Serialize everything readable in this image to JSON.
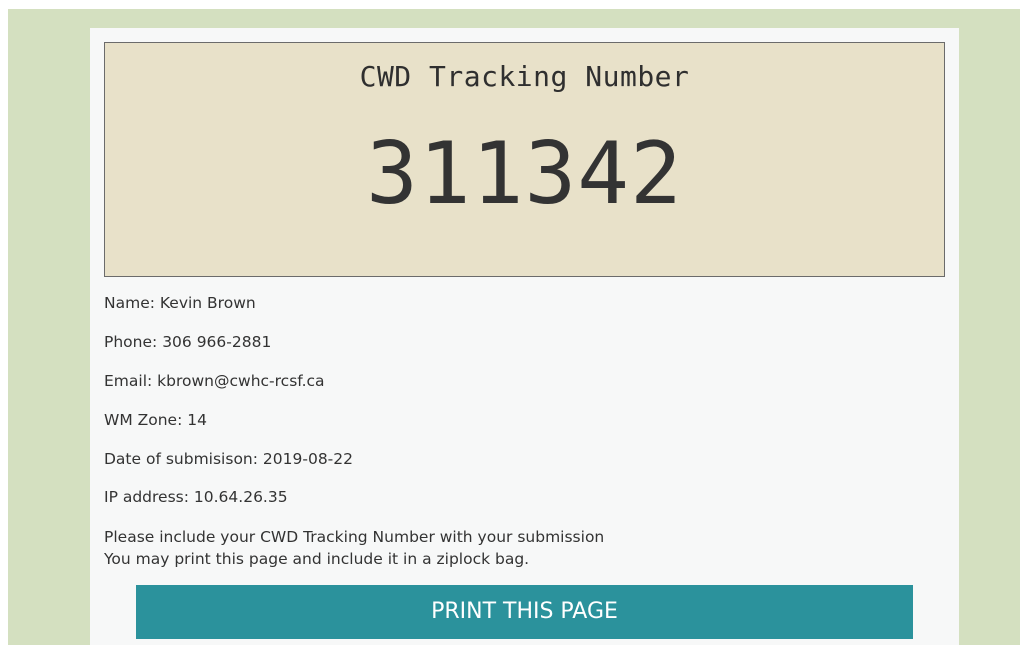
{
  "tracking": {
    "title": "CWD Tracking Number",
    "number": "311342"
  },
  "details": {
    "name_label": "Name:",
    "name_value": "Kevin Brown",
    "phone_label": "Phone:",
    "phone_value": "306 966-2881",
    "email_label": "Email:",
    "email_value": "kbrown@cwhc-rcsf.ca",
    "zone_label": "WM Zone:",
    "zone_value": "14",
    "date_label": "Date of submisison:",
    "date_value": "2019-08-22",
    "ip_label": "IP address:",
    "ip_value": "10.64.26.35"
  },
  "note": {
    "line1": "Please include your CWD Tracking Number with your submission",
    "line2": "You may print this page and include it in a ziplock bag."
  },
  "actions": {
    "print_label": "PRINT THIS PAGE"
  },
  "colors": {
    "outer_background": "#d4e0c0",
    "card_background": "#f7f8f8",
    "tracking_box_background": "#e8e1c9",
    "button_background": "#2b929c",
    "button_text": "#ffffff"
  }
}
